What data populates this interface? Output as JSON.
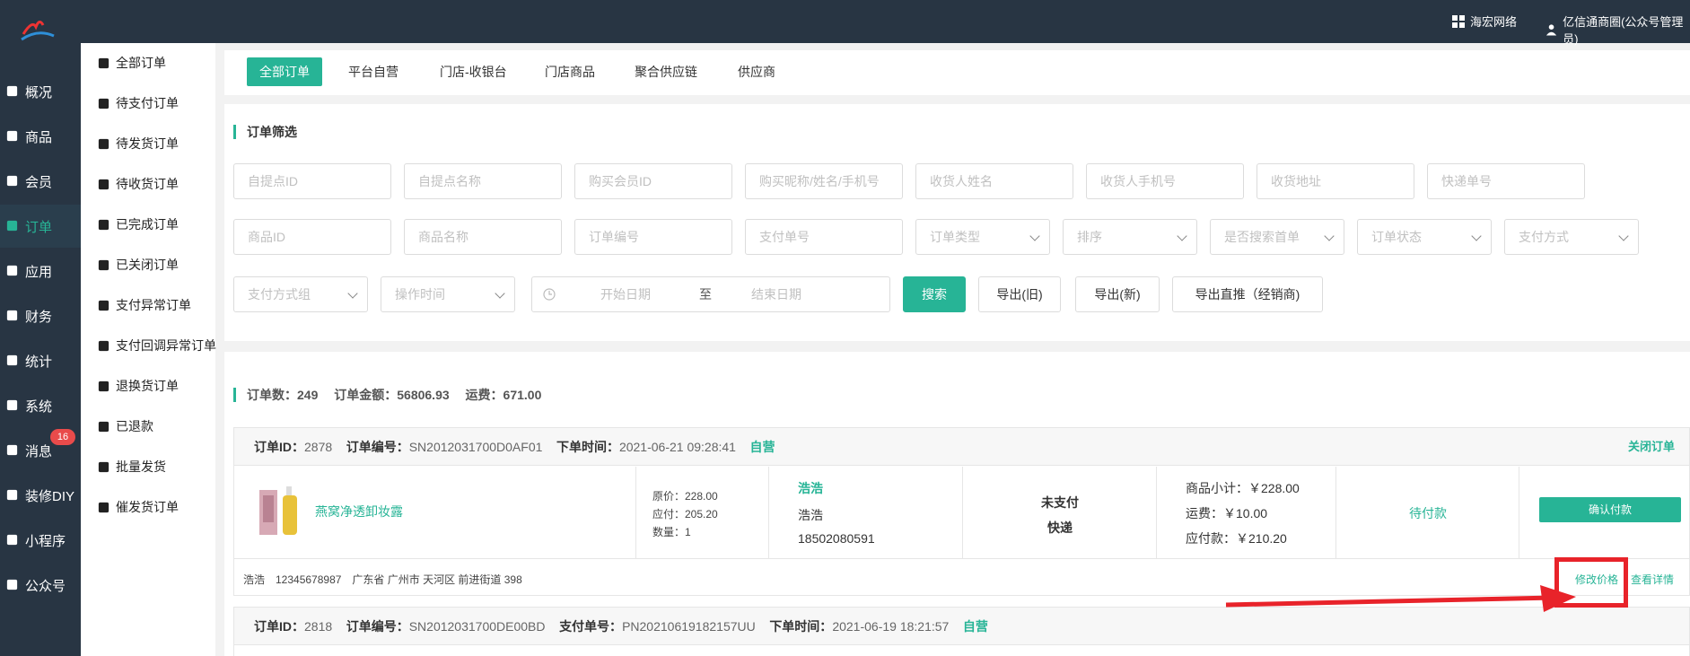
{
  "topbar": {
    "org": "海宏网络",
    "user": "亿信通商圈(公众号管理员)"
  },
  "sidebar": {
    "items": [
      {
        "label": "概况",
        "icon": "overview-icon"
      },
      {
        "label": "商品",
        "icon": "goods-icon"
      },
      {
        "label": "会员",
        "icon": "members-icon"
      },
      {
        "label": "订单",
        "icon": "cart-icon",
        "active": true
      },
      {
        "label": "应用",
        "icon": "apps-icon"
      },
      {
        "label": "财务",
        "icon": "yen-icon"
      },
      {
        "label": "统计",
        "icon": "bar-chart-icon"
      },
      {
        "label": "系统",
        "icon": "gears-icon"
      },
      {
        "label": "消息",
        "icon": "chat-icon"
      },
      {
        "label": "装修DIY",
        "icon": "hammer-icon"
      },
      {
        "label": "小程序",
        "icon": "wechat-icon"
      },
      {
        "label": "公众号",
        "icon": "hourglass-icon"
      }
    ],
    "message_badge": "16"
  },
  "subnav": {
    "items": [
      {
        "label": "全部订单",
        "icon": "copy-icon"
      },
      {
        "label": "待支付订单",
        "icon": "credit-card-icon"
      },
      {
        "label": "待发货订单",
        "icon": "truck-icon"
      },
      {
        "label": "待收货订单",
        "icon": "dropbox-icon"
      },
      {
        "label": "已完成订单",
        "icon": "check-square-icon"
      },
      {
        "label": "已关闭订单",
        "icon": "cup-icon"
      },
      {
        "label": "支付异常订单",
        "icon": "cup-icon"
      },
      {
        "label": "支付回调异常订单",
        "icon": "cup-icon"
      },
      {
        "label": "退换货订单",
        "icon": "refresh-icon"
      },
      {
        "label": "已退款",
        "icon": "share-square-icon"
      },
      {
        "label": "批量发货",
        "icon": "paper-plane-icon"
      },
      {
        "label": "催发货订单",
        "icon": "truck-icon"
      }
    ]
  },
  "tabs": [
    {
      "label": "全部订单",
      "active": true
    },
    {
      "label": "平台自营"
    },
    {
      "label": "门店-收银台"
    },
    {
      "label": "门店商品"
    },
    {
      "label": "聚合供应链"
    },
    {
      "label": "供应商"
    }
  ],
  "filter": {
    "title": "订单筛选",
    "row1": [
      "自提点ID",
      "自提点名称",
      "购买会员ID",
      "购买昵称/姓名/手机号",
      "收货人姓名",
      "收货人手机号",
      "收货地址",
      "快递单号"
    ],
    "row2_inputs": [
      "商品ID",
      "商品名称",
      "订单编号",
      "支付单号"
    ],
    "row2_selects": [
      "订单类型",
      "排序",
      "是否搜索首单",
      "订单状态",
      "支付方式"
    ],
    "row3_selects": [
      "支付方式组",
      "操作时间"
    ],
    "date_start": "开始日期",
    "date_sep": "至",
    "date_end": "结束日期",
    "buttons": {
      "search": "搜索",
      "export_old": "导出(旧)",
      "export_new": "导出(新)",
      "export_direct": "导出直推（经销商)"
    }
  },
  "stats": {
    "count": "订单数：249",
    "amount": "订单金额：56806.93",
    "freight": "运费：671.00"
  },
  "orders": [
    {
      "head": {
        "id_label": "订单ID：",
        "id": "2878",
        "no_label": "订单编号：",
        "no": "SN2012031700D0AF01",
        "time_label": "下单时间：",
        "time": "2021-06-21 09:28:41",
        "tag": "自营",
        "close": "关闭订单"
      },
      "product_name": "燕窝净透卸妆露",
      "price_lines": [
        "原价：228.00",
        "应付：205.20",
        "数量：1"
      ],
      "buyer_nick": "浩浩",
      "buyer_name": "浩浩",
      "buyer_phone": "18502080591",
      "pay_status": "未支付",
      "ship_method": "快递",
      "subtotal": "商品小计：￥228.00",
      "freight": "运费：￥10.00",
      "payable": "应付款：￥210.20",
      "status": "待付款",
      "confirm_btn": "确认付款",
      "address": "浩浩　12345678987　广东省 广州市 天河区 前进街道 398",
      "edit_price": "修改价格",
      "view_detail": "查看详情"
    },
    {
      "head": {
        "id_label": "订单ID：",
        "id": "2818",
        "no_label": "订单编号：",
        "no": "SN2012031700DE00BD",
        "pay_label": "支付单号：",
        "pay_no": "PN20210619182157UU",
        "time_label": "下单时间：",
        "time": "2021-06-19 18:21:57",
        "tag": "自营"
      }
    }
  ],
  "colors": {
    "accent": "#27b496",
    "topbar": "#283543",
    "highlight": "#e8232a"
  }
}
